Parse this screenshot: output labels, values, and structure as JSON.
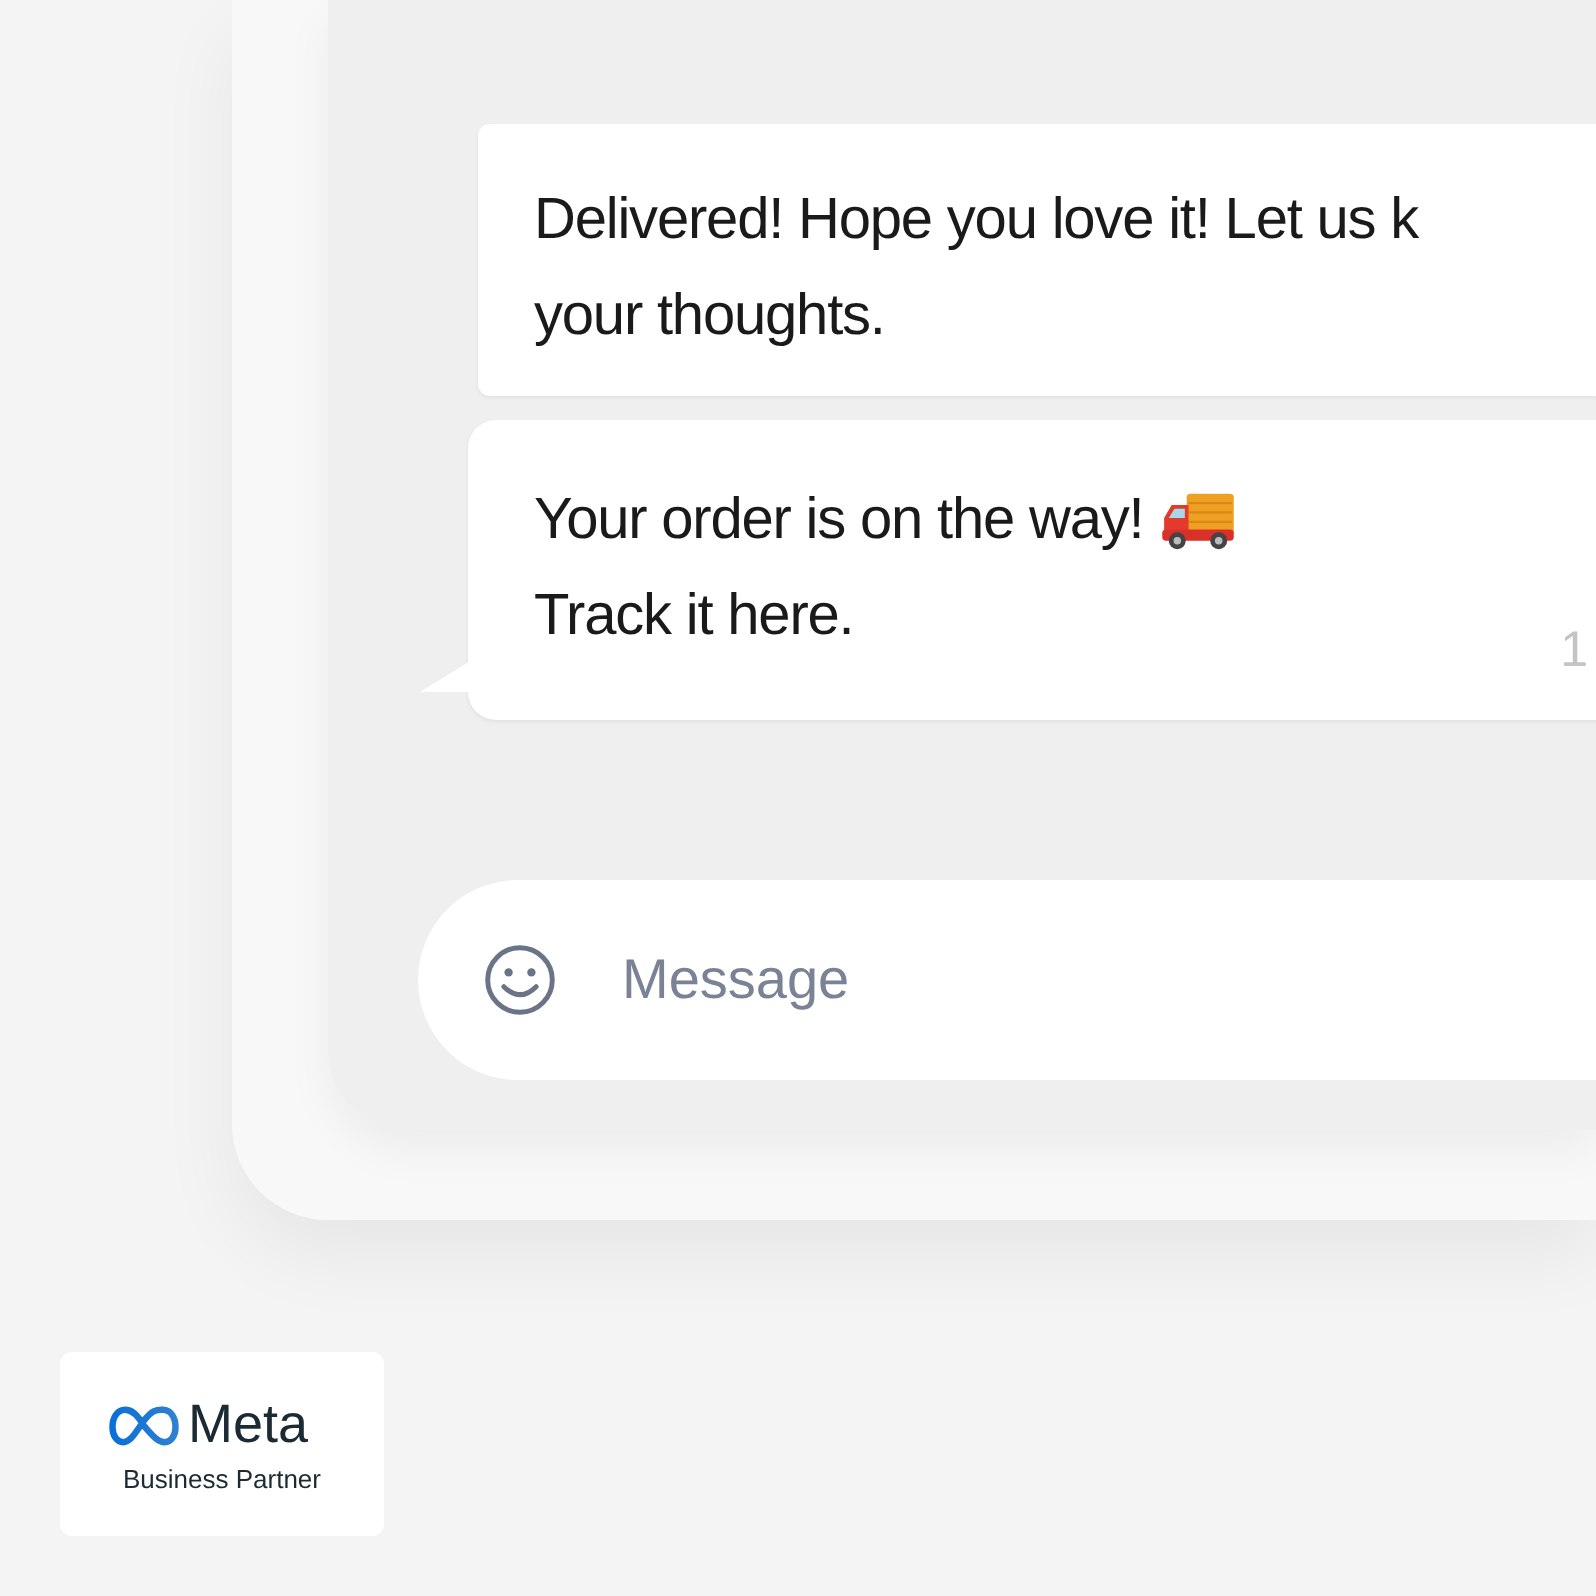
{
  "messages": [
    {
      "kind": "plain",
      "lines": [
        "Delivered! Hope you love it! Let us k",
        "your thoughts."
      ],
      "tail": false
    },
    {
      "kind": "truck",
      "lines": [
        "Your order is on the way!",
        "Track it here."
      ],
      "time": "1",
      "tail": true
    }
  ],
  "composer": {
    "placeholder": "Message"
  },
  "badge": {
    "brand": "Meta",
    "subtitle": "Business Partner"
  }
}
